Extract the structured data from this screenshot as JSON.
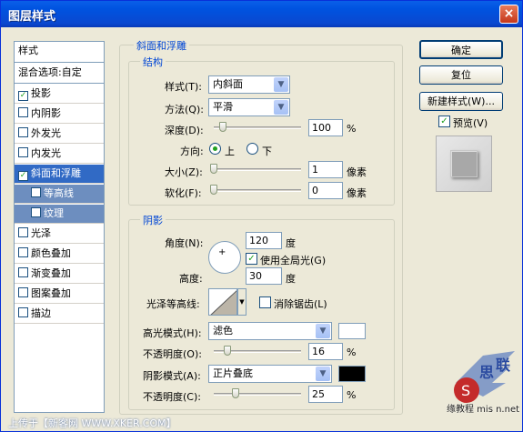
{
  "window": {
    "title": "图层样式",
    "close": "×"
  },
  "left_panel": {
    "header": "样式",
    "blend": "混合选项:自定",
    "items": [
      {
        "label": "投影",
        "checked": true
      },
      {
        "label": "内阴影",
        "checked": false
      },
      {
        "label": "外发光",
        "checked": false
      },
      {
        "label": "内发光",
        "checked": false
      },
      {
        "label": "斜面和浮雕",
        "checked": true,
        "selected": true
      },
      {
        "label": "等高线",
        "checked": false,
        "sub": true
      },
      {
        "label": "纹理",
        "checked": false,
        "sub": true
      },
      {
        "label": "光泽",
        "checked": false
      },
      {
        "label": "颜色叠加",
        "checked": false
      },
      {
        "label": "渐变叠加",
        "checked": false
      },
      {
        "label": "图案叠加",
        "checked": false
      },
      {
        "label": "描边",
        "checked": false
      }
    ]
  },
  "bevel": {
    "section_title": "斜面和浮雕",
    "structure": {
      "title": "结构",
      "style_label": "样式(T):",
      "style_value": "内斜面",
      "technique_label": "方法(Q):",
      "technique_value": "平滑",
      "depth_label": "深度(D):",
      "depth_value": "100",
      "depth_unit": "%",
      "depth_level": 0.1,
      "direction_label": "方向:",
      "dir_up": "上",
      "dir_down": "下",
      "size_label": "大小(Z):",
      "size_value": "1",
      "size_unit": "像素",
      "soften_label": "软化(F):",
      "soften_value": "0",
      "soften_unit": "像素"
    },
    "shading": {
      "title": "阴影",
      "angle_label": "角度(N):",
      "angle_value": "120",
      "angle_unit": "度",
      "global_light": "使用全局光(G)",
      "altitude_label": "高度:",
      "altitude_value": "30",
      "altitude_unit": "度",
      "gloss_label": "光泽等高线:",
      "antialias": "消除锯齿(L)",
      "highlight_mode_label": "高光模式(H):",
      "highlight_mode_value": "滤色",
      "highlight_color": "#ffffff",
      "hl_opacity_label": "不透明度(O):",
      "hl_opacity_value": "16",
      "hl_opacity_unit": "%",
      "shadow_mode_label": "阴影模式(A):",
      "shadow_mode_value": "正片叠底",
      "shadow_color": "#000000",
      "sh_opacity_label": "不透明度(C):",
      "sh_opacity_value": "25",
      "sh_opacity_unit": "%"
    }
  },
  "buttons": {
    "ok": "确定",
    "reset": "复位",
    "new_style": "新建样式(W)...",
    "preview": "预览(V)"
  },
  "watermark": {
    "left": "上传于【新客网 WWW.XKER.COM】",
    "right": "缘教程 mis  n.net"
  }
}
